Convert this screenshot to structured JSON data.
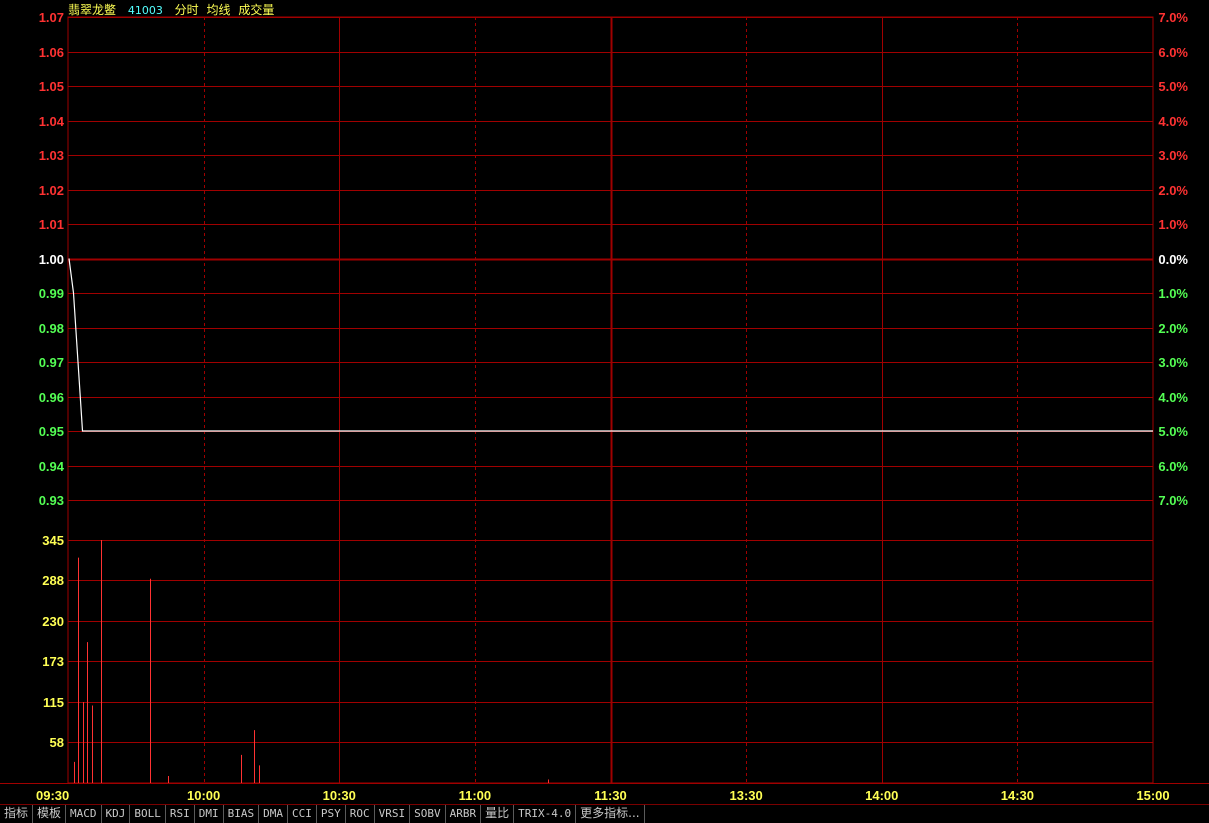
{
  "header": {
    "stock_name": "翡翠龙鳖",
    "stock_code": "41003",
    "options": [
      "分时",
      "均线",
      "成交量"
    ]
  },
  "colors": {
    "grid": "#a00000",
    "up": "#ff3232",
    "down": "#54ff54",
    "neutral": "#ffffff",
    "volume_axis": "#ffff54",
    "time_axis": "#ffff54",
    "price_line": "#ffffff",
    "volume_bar": "#ff3232"
  },
  "tabs": [
    "指标",
    "模板",
    "MACD",
    "KDJ",
    "BOLL",
    "RSI",
    "DMI",
    "BIAS",
    "DMA",
    "CCI",
    "PSY",
    "ROC",
    "VRSI",
    "SOBV",
    "ARBR",
    "量比",
    "TRIX-4.0",
    "更多指标..."
  ],
  "chart_data": {
    "type": "line",
    "title": "翡翠龙鳖 41003",
    "price_axis": {
      "ticks": [
        "1.07",
        "1.06",
        "1.05",
        "1.04",
        "1.03",
        "1.02",
        "1.01",
        "1.00",
        "0.99",
        "0.98",
        "0.97",
        "0.96",
        "0.95",
        "0.94",
        "0.93"
      ],
      "range": [
        0.93,
        1.07
      ],
      "prev_close": 1.0
    },
    "percent_axis": {
      "ticks": [
        "7.0%",
        "6.0%",
        "5.0%",
        "4.0%",
        "3.0%",
        "2.0%",
        "1.0%",
        "0.0%",
        "1.0%",
        "2.0%",
        "3.0%",
        "4.0%",
        "5.0%",
        "6.0%",
        "7.0%"
      ]
    },
    "volume_axis": {
      "ticks": [
        "345",
        "288",
        "230",
        "173",
        "115",
        "58"
      ],
      "range": [
        0,
        345
      ]
    },
    "time_axis": {
      "ticks": [
        "09:30",
        "10:00",
        "10:30",
        "11:00",
        "11:30",
        "13:30",
        "14:00",
        "14:30",
        "15:00"
      ]
    },
    "price_series": {
      "minute_index": [
        0,
        1,
        2,
        3,
        240
      ],
      "price": [
        1.0,
        0.99,
        0.97,
        0.95,
        0.95
      ]
    },
    "volume_series": {
      "minute_index": [
        1,
        2,
        3,
        4,
        5,
        7,
        18,
        22,
        38,
        41,
        42,
        106
      ],
      "volume": [
        30,
        320,
        115,
        200,
        110,
        345,
        290,
        10,
        40,
        75,
        25,
        5
      ]
    },
    "grid": true
  }
}
